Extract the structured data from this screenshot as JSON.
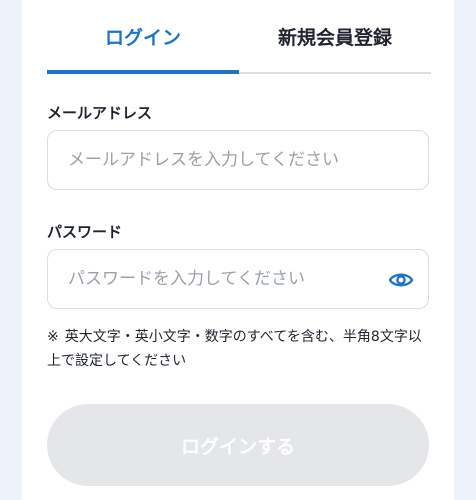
{
  "tabs": {
    "login": "ログイン",
    "register": "新規会員登録"
  },
  "email": {
    "label": "メールアドレス",
    "placeholder": "メールアドレスを入力してください",
    "value": ""
  },
  "password": {
    "label": "パスワード",
    "placeholder": "パスワードを入力してください",
    "value": "",
    "toggle_icon": "eye-icon"
  },
  "note": {
    "mark": "※",
    "text": "英大文字・英小文字・数字のすべてを含む、半角8文字以上で設定してください"
  },
  "submit_label": "ログインする",
  "colors": {
    "accent": "#1e73c9",
    "disabled_button": "#e4e6ea",
    "background": "#eef3fb"
  }
}
